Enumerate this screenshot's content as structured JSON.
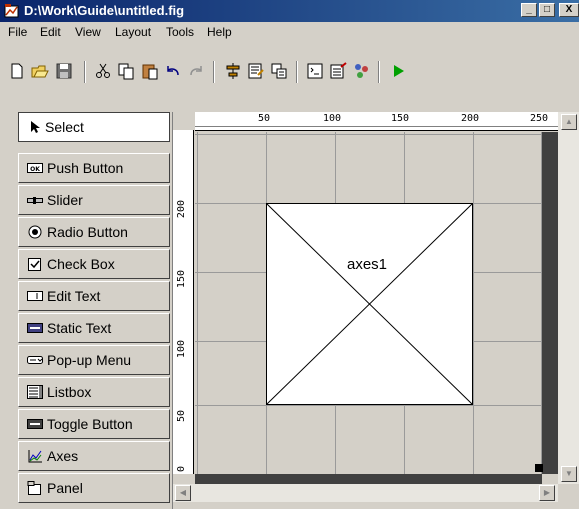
{
  "window": {
    "title": "D:\\Work\\Guide\\untitled.fig",
    "min_label": "_",
    "max_label": "□",
    "close_label": "X"
  },
  "menu": [
    "File",
    "Edit",
    "View",
    "Layout",
    "Tools",
    "Help"
  ],
  "toolbar_icons": [
    "new-icon",
    "open-icon",
    "save-icon",
    "cut-icon",
    "copy-icon",
    "paste-icon",
    "undo-icon",
    "redo-icon",
    "align-icon",
    "menu-editor-icon",
    "tab-order-icon",
    "mfile-editor-icon",
    "property-inspector-icon",
    "object-browser-icon",
    "run-icon"
  ],
  "palette": {
    "select": "Select",
    "items": [
      "Push Button",
      "Slider",
      "Radio Button",
      "Check Box",
      "Edit Text",
      "Static Text",
      "Pop-up Menu",
      "Listbox",
      "Toggle Button",
      "Axes",
      "Panel"
    ]
  },
  "ruler": {
    "x_ticks": [
      "50",
      "100",
      "150",
      "200",
      "250"
    ],
    "y_ticks": [
      "200",
      "150",
      "100",
      "50",
      "0"
    ]
  },
  "axes_label": "axes1",
  "colors": {
    "title_start": "#0a246a",
    "title_end": "#3a6ea5",
    "face": "#d4d0c8",
    "run_green": "#00a000"
  }
}
